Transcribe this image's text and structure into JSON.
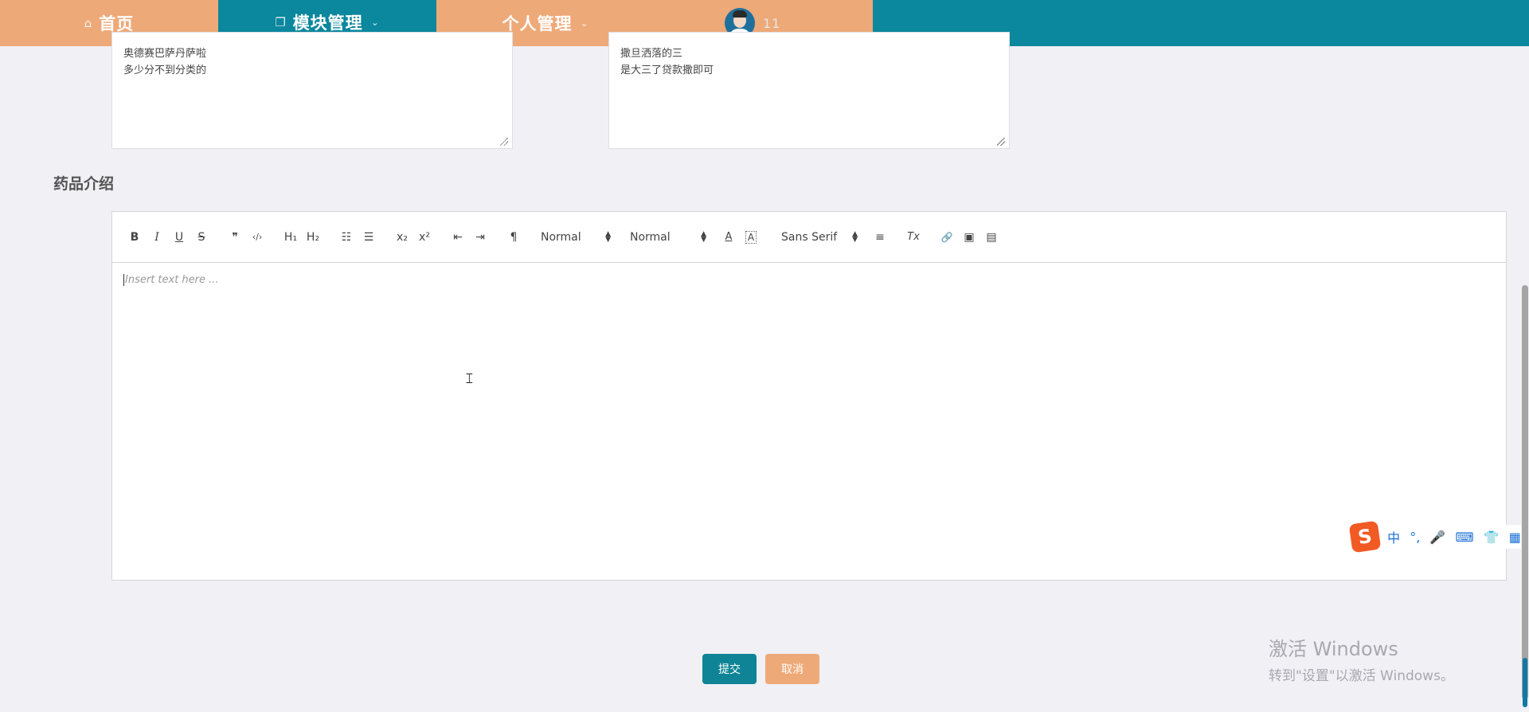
{
  "nav": {
    "home_label": "首页",
    "home_icon": "home-icon",
    "module_label": "模块管理",
    "module_icon": "window-icon",
    "personal_label": "个人管理",
    "username": "11",
    "colors": {
      "orange": "#eea978",
      "teal": "#0b879e",
      "active_underline": "#2f8fe0"
    }
  },
  "textareas": {
    "left_value": "奥德赛巴萨丹萨啦\n多少分不到分类的",
    "right_value": "撒旦洒落的三\n是大三了贷款撒即可"
  },
  "section": {
    "label": "药品介绍"
  },
  "editor": {
    "toolbar": {
      "bold": "B",
      "italic": "I",
      "underline": "U",
      "strike": "S",
      "blockquote": "❞",
      "code": "‹/›",
      "h1": "H₁",
      "h2": "H₂",
      "ordered_list": "☷",
      "bullet_list": "☰",
      "subscript": "x₂",
      "superscript": "x²",
      "outdent": "⇤",
      "indent": "⇥",
      "direction": "¶",
      "size_value": "Normal",
      "header_value": "Normal",
      "font_color": "A",
      "background_color": "A",
      "font_value": "Sans Serif",
      "align": "≡",
      "clean": "Tx",
      "link": "🔗",
      "image": "▣",
      "video": "▤"
    },
    "placeholder": "Insert text here ..."
  },
  "buttons": {
    "submit": "提交",
    "cancel": "取消"
  },
  "ime": {
    "logo": "S",
    "items": [
      "中",
      "°,",
      "🎤",
      "⌨",
      "👕",
      "▦"
    ]
  },
  "watermark": {
    "title": "激活 Windows",
    "subtitle": "转到\"设置\"以激活 Windows。"
  }
}
